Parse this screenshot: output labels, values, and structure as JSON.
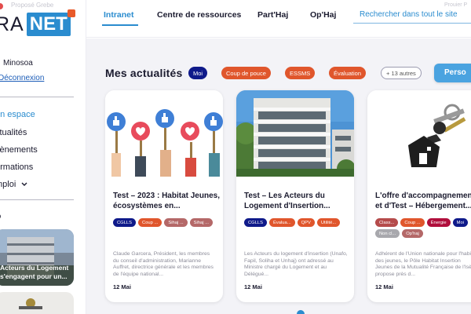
{
  "app": {
    "logo_left": "RA",
    "logo_right": "NET",
    "top_faded": "Proposé Grebe",
    "top_right_faded": "Prouier P"
  },
  "user": {
    "name": "Minosoa",
    "logout": "Déconnexion"
  },
  "sidebar": {
    "items": [
      {
        "label": "on espace",
        "active": true
      },
      {
        "label": "ctualités",
        "active": false
      },
      {
        "label": "vènements",
        "active": false
      },
      {
        "label": "ormations",
        "active": false
      },
      {
        "label": "mploi",
        "active": false
      }
    ],
    "section_heading": "o",
    "cards": [
      {
        "text_line1": "Acteurs du Logement",
        "text_line2": "s'engagent pour un..."
      }
    ]
  },
  "topnav": {
    "tabs": [
      {
        "label": "Intranet",
        "active": true
      },
      {
        "label": "Centre de ressources",
        "active": false
      },
      {
        "label": "Part'Haj",
        "active": false
      },
      {
        "label": "Op'Haj",
        "active": false
      }
    ],
    "search_placeholder": "Rechercher dans tout le site"
  },
  "feed": {
    "title": "Mes actualités",
    "chips": [
      {
        "label": "Moi",
        "color": "#0f1a8a"
      },
      {
        "label": "Coup de pouce",
        "color": "#e0562c"
      },
      {
        "label": "ESSMS",
        "color": "#e0562c"
      },
      {
        "label": "Évaluation",
        "color": "#e0562c"
      }
    ],
    "more_chip": "+ 13 autres",
    "perso_button": "Perso",
    "cards": [
      {
        "title": "Test – 2023 : Habitat Jeunes, écosystèmes en...",
        "tags": [
          {
            "label": "CGLLS",
            "color": "#0f1a8a"
          },
          {
            "label": "Coup ...",
            "color": "#e0562c"
          },
          {
            "label": "Sihaj ...",
            "color": "#b46868"
          },
          {
            "label": "Sihaj ...",
            "color": "#b46868"
          }
        ],
        "description": "Claude Garcera, Président, les membres du conseil d'administration, Marianne Auffret, directrice générale et les membres de l'équipe national...",
        "date": "12 Mai",
        "image": "thumbs-hearts-illustration"
      },
      {
        "title": "Test – Les Acteurs du Logement d'Insertion...",
        "tags": [
          {
            "label": "CGLLS",
            "color": "#0f1a8a"
          },
          {
            "label": "Évalua...",
            "color": "#e0562c"
          },
          {
            "label": "QPV",
            "color": "#e0562c"
          },
          {
            "label": "Utilité...",
            "color": "#e0562c"
          }
        ],
        "description": "Les Acteurs du logement d'insertion (Unafo, Fapil, Soliha et Unhaj) ont adressé au Ministre chargé du Logement et au Délégué...",
        "date": "12 Mai",
        "image": "apartment-building-photo"
      },
      {
        "title": "L'offre d'accompagnement et d'Test – Hébergement...",
        "tags": [
          {
            "label": "Class...",
            "color": "#b54b4b"
          },
          {
            "label": "Coup ...",
            "color": "#e0562c"
          },
          {
            "label": "Énergie",
            "color": "#b00e3c"
          },
          {
            "label": "Moi",
            "color": "#0f1a8a"
          },
          {
            "label": "Non cl...",
            "color": "#a8a8ad"
          },
          {
            "label": "Op'haj",
            "color": "#b46868"
          }
        ],
        "description": "Adhérent de l'Union nationale pour l'habitat des jeunes, le Pôle Habitat Insertion Jeunes de la Mutualité Française de l'Isère propose près d...",
        "date": "12 Mai",
        "image": "house-keys-photo"
      }
    ]
  }
}
